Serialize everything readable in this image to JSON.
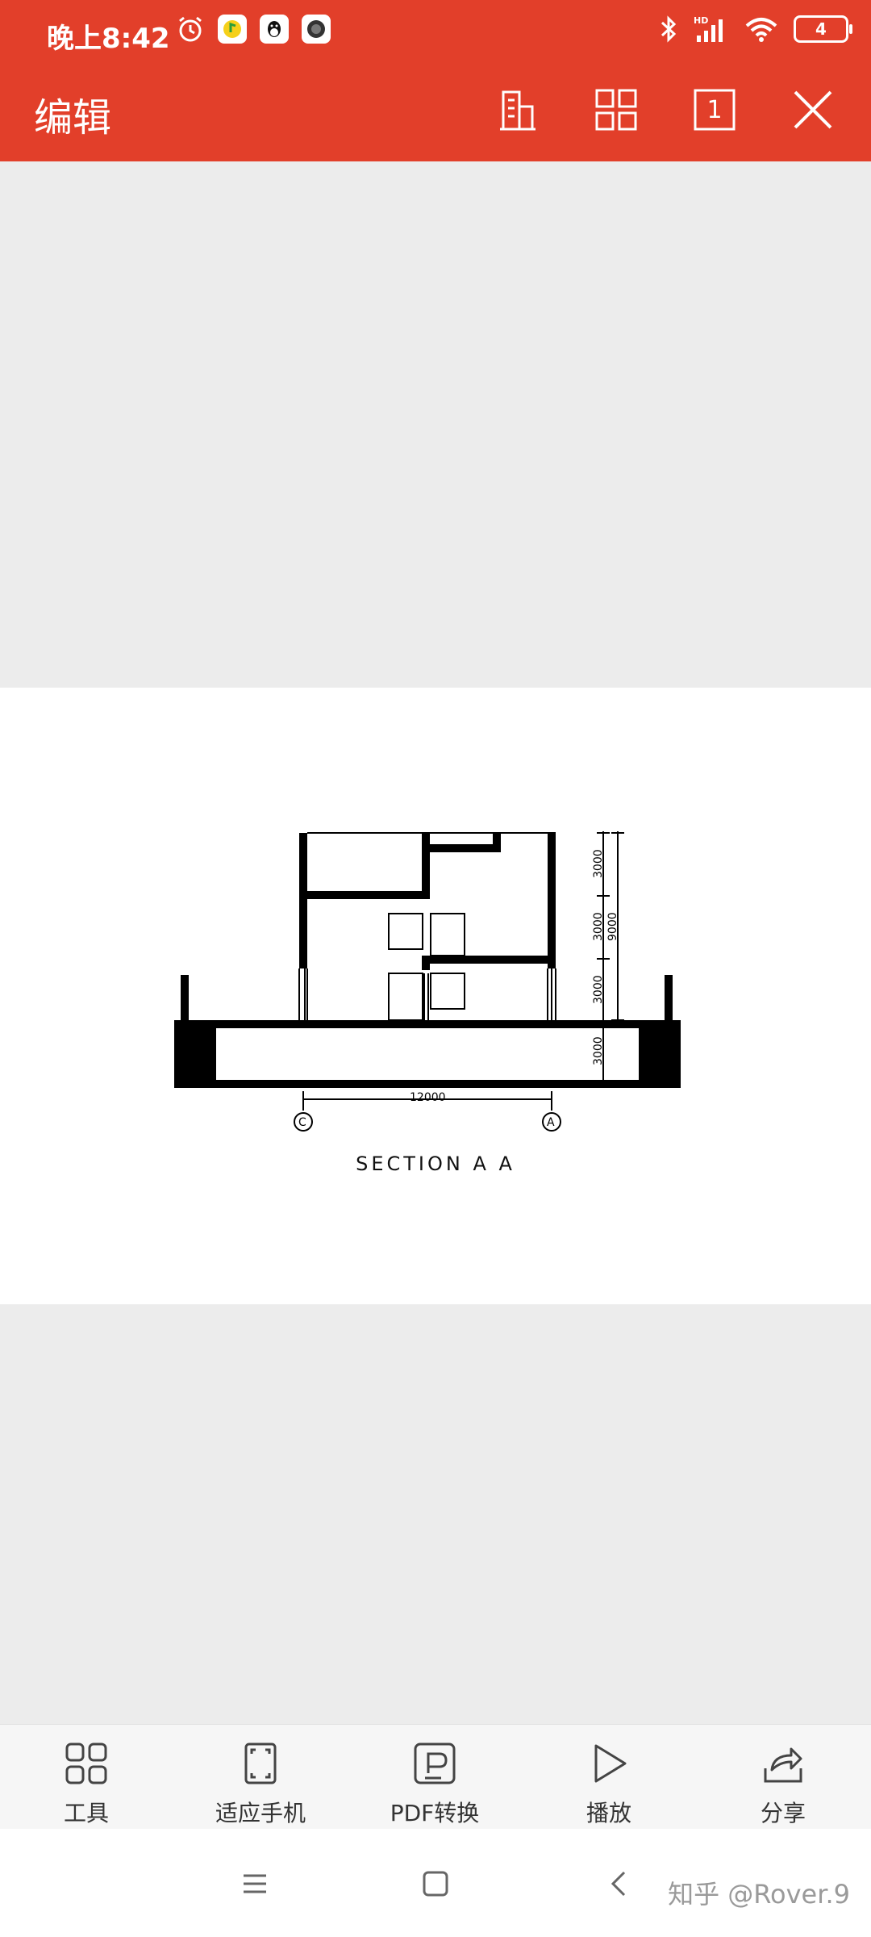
{
  "status": {
    "time": "晚上8:42",
    "battery": "4",
    "icons": [
      "alarm-icon",
      "music-icon",
      "qq-icon",
      "app-icon",
      "bluetooth-icon",
      "signal-icon",
      "wifi-icon",
      "battery-icon"
    ]
  },
  "toolbar": {
    "title": "编辑",
    "icons": [
      "building-icon",
      "grid-icon",
      "page-number-icon",
      "close-icon"
    ],
    "page_number": "1"
  },
  "drawing": {
    "section_title": "SECTION A A",
    "dims_vertical": [
      "3000",
      "3000",
      "3000",
      "3000"
    ],
    "dim_total": "9000",
    "dim_horizontal": "12000",
    "grid_left": "C",
    "grid_right": "A"
  },
  "bottom_bar": {
    "items": [
      {
        "label": "工具",
        "icon": "tools-icon"
      },
      {
        "label": "适应手机",
        "icon": "fit-screen-icon"
      },
      {
        "label": "PDF转换",
        "icon": "pdf-convert-icon"
      },
      {
        "label": "播放",
        "icon": "play-icon"
      },
      {
        "label": "分享",
        "icon": "share-icon"
      }
    ]
  },
  "nav": {
    "icons": [
      "menu-icon",
      "home-icon",
      "back-icon"
    ],
    "watermark": "知乎 @Rover.9"
  },
  "colors": {
    "accent": "#e23f2a",
    "background": "#ececec",
    "page": "#ffffff"
  }
}
